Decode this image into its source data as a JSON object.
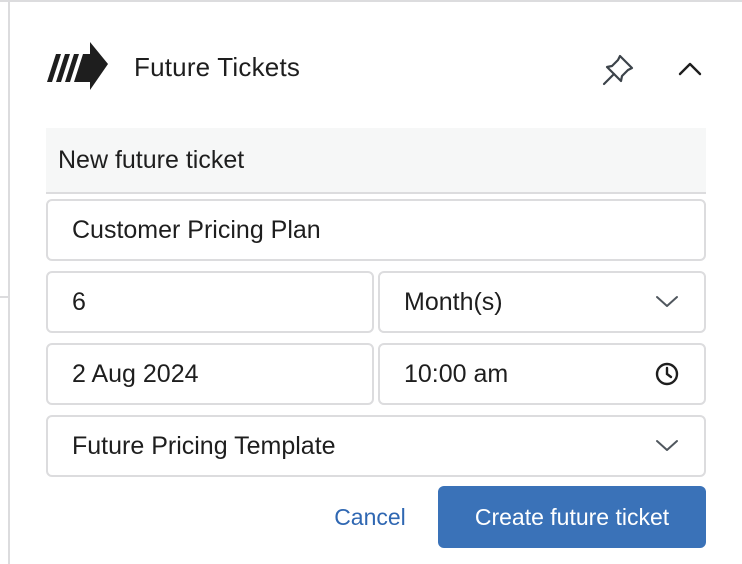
{
  "panel": {
    "title": "Future Tickets",
    "logo_icon": "arrow-stripes-logo-icon",
    "pin_icon": "pin-icon",
    "collapse_icon": "chevron-up-icon"
  },
  "form": {
    "section_title": "New future ticket",
    "name_value": "Customer Pricing Plan",
    "interval_value": "6",
    "interval_unit": "Month(s)",
    "date_value": "2 Aug 2024",
    "time_value": "10:00 am",
    "template_value": "Future Pricing Template"
  },
  "actions": {
    "cancel_label": "Cancel",
    "create_label": "Create future ticket"
  },
  "colors": {
    "primary": "#3a72b8",
    "link": "#2f67b2",
    "border": "#dcdcde",
    "section_bg": "#f6f7f7"
  }
}
